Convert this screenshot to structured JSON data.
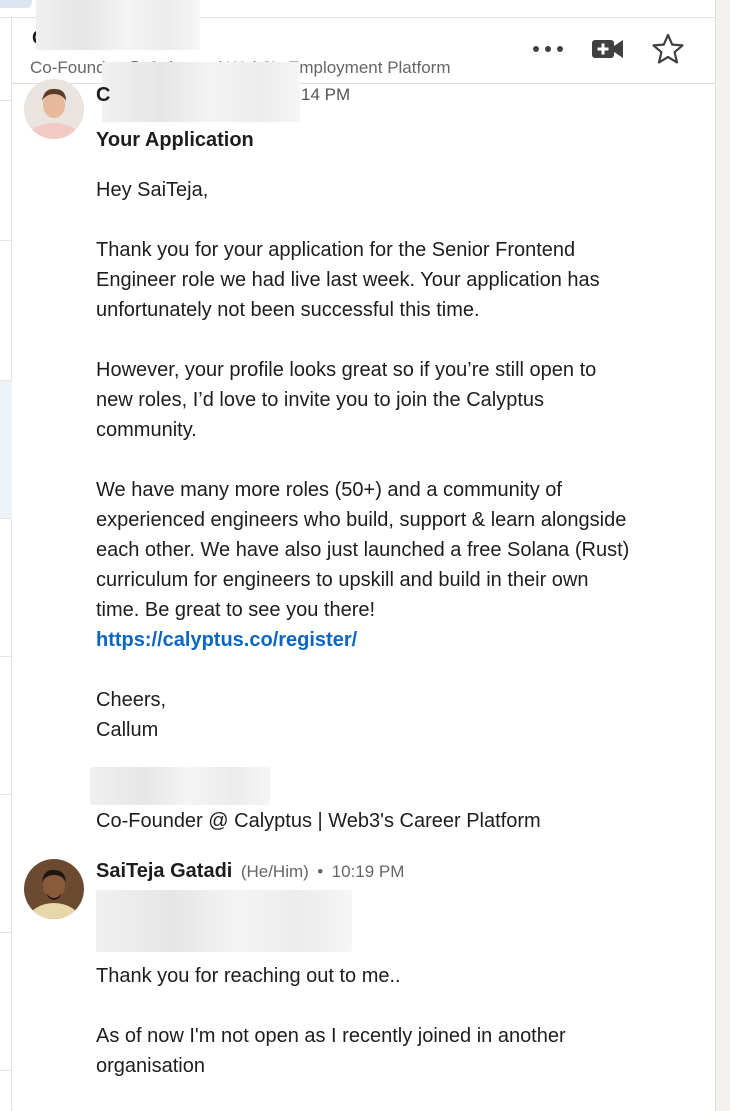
{
  "header": {
    "name_initial": "C",
    "subtitle": "Co-Founder @ Calyptus | Web3's Employment Platform",
    "actions": [
      "more-options",
      "video-call",
      "star"
    ]
  },
  "message1": {
    "sender_initial": "C",
    "time_fragment": "14 PM",
    "subject": "Your Application",
    "greeting": "Hey SaiTeja,",
    "paragraphs": [
      "Thank you for your application for the Senior Frontend Engineer role we had live last week. Your application has unfortunately not been successful this time.",
      "However, your profile looks great so if you’re still open to new roles, I’d love to invite you to join the Calyptus community.",
      "We have many more roles (50+) and a community of experienced engineers who build, support & learn alongside each other. We have also just launched a free Solana (Rust) curriculum for engineers to upskill and build in their own time. Be great to see you there!"
    ],
    "link": "https://calyptus.co/register/",
    "signoff": "Cheers,",
    "signoff_name": "Callum",
    "signature_title": "Co-Founder @ Calyptus | Web3's Career Platform"
  },
  "message2": {
    "sender_name": "SaiTeja Gatadi",
    "pronouns": "(He/Him)",
    "separator": "•",
    "time": "10:19 PM",
    "paragraphs": [
      "Thank you for reaching out to me..",
      "As of now I'm not open as I recently joined in another organisation"
    ]
  },
  "colors": {
    "link": "#0a66c2",
    "text": "#1d1d1d",
    "muted": "#666666"
  }
}
